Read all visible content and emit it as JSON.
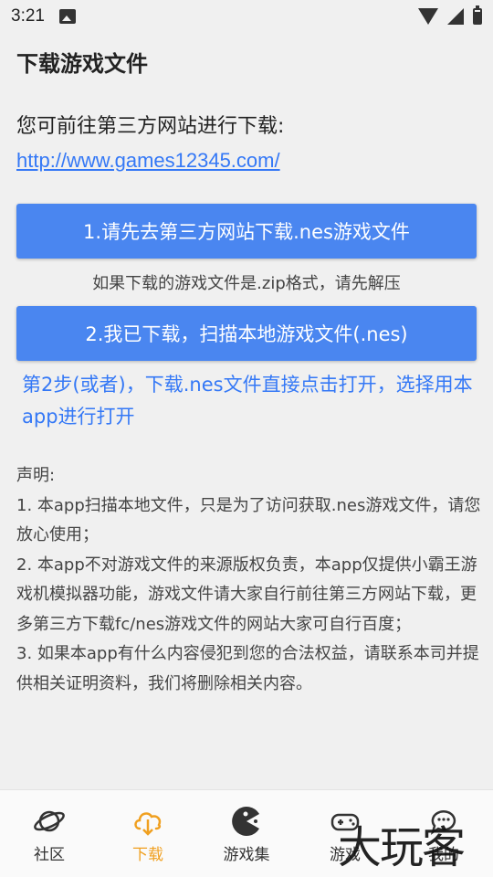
{
  "status": {
    "time": "3:21"
  },
  "header": {
    "title": "下载游戏文件"
  },
  "content": {
    "intro": "您可前往第三方网站进行下载:",
    "link": "http://www.games12345.com/",
    "button1": "1.请先去第三方网站下载.nes游戏文件",
    "hint": "如果下载的游戏文件是.zip格式，请先解压",
    "button2": "2.我已下载，扫描本地游戏文件(.nes)",
    "step2": "第2步(或者)，下载.nes文件直接点击打开，选择用本app进行打开"
  },
  "declaration": {
    "title": "声明:",
    "lines": [
      "1. 本app扫描本地文件，只是为了访问获取.nes游戏文件，请您放心使用；",
      "2. 本app不对游戏文件的来源版权负责，本app仅提供小霸王游戏机模拟器功能，游戏文件请大家自行前往第三方网站下载，更多第三方下载fc/nes游戏文件的网站大家可自行百度；",
      "3. 如果本app有什么内容侵犯到您的合法权益，请联系本司并提供相关证明资料，我们将删除相关内容。"
    ]
  },
  "nav": {
    "items": [
      {
        "label": "社区",
        "icon": "planet-icon"
      },
      {
        "label": "下载",
        "icon": "cloud-download-icon",
        "active": true
      },
      {
        "label": "游戏集",
        "icon": "pacman-icon"
      },
      {
        "label": "游戏",
        "icon": "gamepad-icon"
      },
      {
        "label": "我的",
        "icon": "chat-icon"
      }
    ]
  },
  "watermark": "大玩客",
  "colors": {
    "accent": "#4a86f0",
    "link": "#3478f6",
    "active_tab": "#f0a020"
  }
}
